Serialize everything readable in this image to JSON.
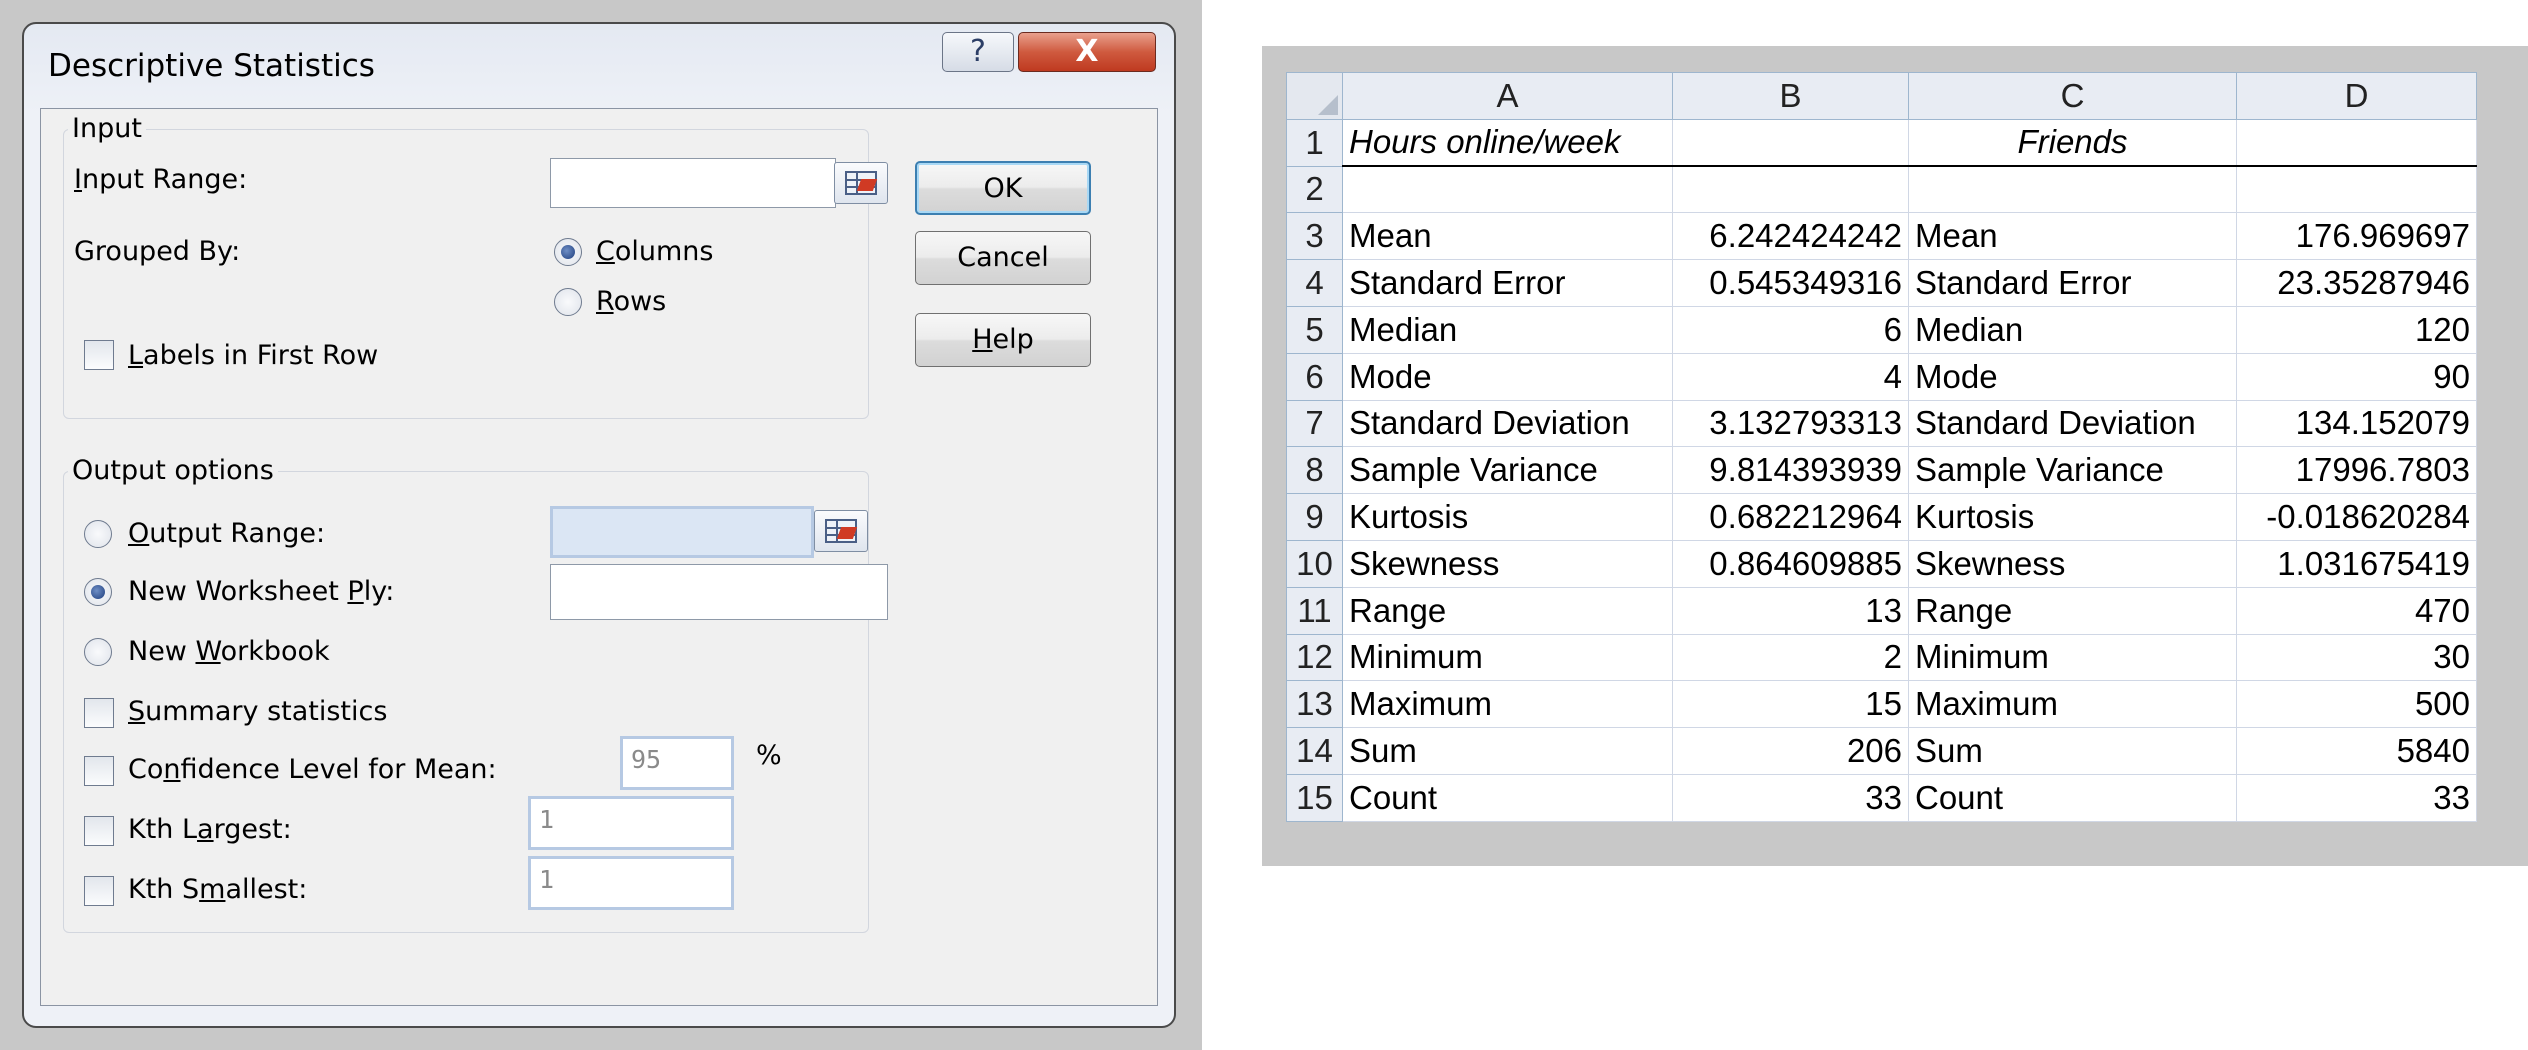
{
  "dialog": {
    "title": "Descriptive Statistics",
    "help_glyph": "?",
    "close_glyph": "X",
    "input_group": {
      "legend": "Input",
      "input_range_label": {
        "pre": "",
        "u": "I",
        "post": "nput Range:"
      },
      "input_range_value": "",
      "grouped_by_label": "Grouped By:",
      "columns_label": {
        "pre": "",
        "u": "C",
        "post": "olumns"
      },
      "rows_label": {
        "pre": "",
        "u": "R",
        "post": "ows"
      },
      "grouped_by_selected": "Columns",
      "labels_first_row": {
        "pre": "",
        "u": "L",
        "post": "abels in First Row"
      }
    },
    "output_group": {
      "legend": "Output options",
      "output_range": {
        "pre": "",
        "u": "O",
        "post": "utput Range:"
      },
      "new_ply": {
        "pre": "New Worksheet ",
        "u": "P",
        "post": "ly:"
      },
      "new_workbook": {
        "pre": "New ",
        "u": "W",
        "post": "orkbook"
      },
      "selected": "New Worksheet Ply",
      "summary_statistics": {
        "pre": "",
        "u": "S",
        "post": "ummary statistics"
      },
      "confidence_level": {
        "pre": "Co",
        "u": "n",
        "post": "fidence Level for Mean:"
      },
      "confidence_value": "95",
      "percent": "%",
      "kth_largest": {
        "pre": "Kth L",
        "u": "a",
        "post": "rgest:"
      },
      "kth_largest_value": "1",
      "kth_smallest": {
        "pre": "Kth S",
        "u": "m",
        "post": "allest:"
      },
      "kth_smallest_value": "1"
    },
    "buttons": {
      "ok": "OK",
      "cancel": "Cancel",
      "help": {
        "pre": "",
        "u": "H",
        "post": "elp"
      }
    }
  },
  "sheet": {
    "columns": [
      "A",
      "B",
      "C",
      "D"
    ],
    "rows": [
      {
        "n": "1",
        "a": "Hours online/week",
        "b": "",
        "c": "Friends",
        "d": ""
      },
      {
        "n": "2",
        "a": "",
        "b": "",
        "c": "",
        "d": ""
      },
      {
        "n": "3",
        "a": "Mean",
        "b": "6.242424242",
        "c": "Mean",
        "d": "176.969697"
      },
      {
        "n": "4",
        "a": "Standard Error",
        "b": "0.545349316",
        "c": "Standard Error",
        "d": "23.35287946"
      },
      {
        "n": "5",
        "a": "Median",
        "b": "6",
        "c": "Median",
        "d": "120"
      },
      {
        "n": "6",
        "a": "Mode",
        "b": "4",
        "c": "Mode",
        "d": "90"
      },
      {
        "n": "7",
        "a": "Standard Deviation",
        "b": "3.132793313",
        "c": "Standard Deviation",
        "d": "134.152079"
      },
      {
        "n": "8",
        "a": "Sample Variance",
        "b": "9.814393939",
        "c": "Sample Variance",
        "d": "17996.7803"
      },
      {
        "n": "9",
        "a": "Kurtosis",
        "b": "0.682212964",
        "c": "Kurtosis",
        "d": "-0.018620284"
      },
      {
        "n": "10",
        "a": "Skewness",
        "b": "0.864609885",
        "c": "Skewness",
        "d": "1.031675419"
      },
      {
        "n": "11",
        "a": "Range",
        "b": "13",
        "c": "Range",
        "d": "470"
      },
      {
        "n": "12",
        "a": "Minimum",
        "b": "2",
        "c": "Minimum",
        "d": "30"
      },
      {
        "n": "13",
        "a": "Maximum",
        "b": "15",
        "c": "Maximum",
        "d": "500"
      },
      {
        "n": "14",
        "a": "Sum",
        "b": "206",
        "c": "Sum",
        "d": "5840"
      },
      {
        "n": "15",
        "a": "Count",
        "b": "33",
        "c": "Count",
        "d": "33"
      }
    ]
  }
}
